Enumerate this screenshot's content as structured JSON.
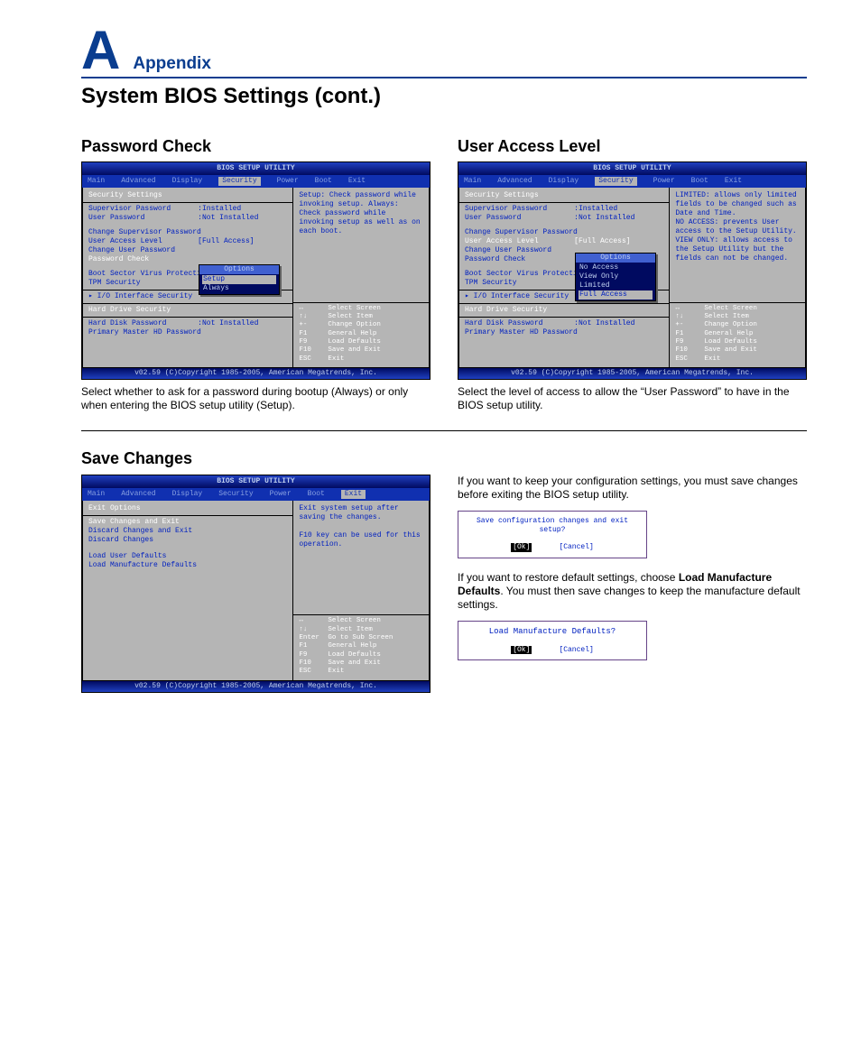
{
  "header": {
    "letter": "A",
    "label": "Appendix"
  },
  "page_title": "System BIOS Settings (cont.)",
  "bios_common": {
    "title": "BIOS SETUP UTILITY",
    "footer": "v02.59 (C)Copyright 1985-2005, American Megatrends, Inc.",
    "tabs": [
      "Main",
      "Advanced",
      "Display",
      "Security",
      "Power",
      "Boot",
      "Exit"
    ],
    "keyhelp": [
      [
        "↔",
        "Select Screen"
      ],
      [
        "↑↓",
        "Select Item"
      ],
      [
        "+-",
        "Change Option"
      ],
      [
        "F1",
        "General Help"
      ],
      [
        "F9",
        "Load Defaults"
      ],
      [
        "F10",
        "Save and Exit"
      ],
      [
        "ESC",
        "Exit"
      ]
    ],
    "keyhelp_exit": [
      [
        "↔",
        "Select Screen"
      ],
      [
        "↑↓",
        "Select Item"
      ],
      [
        "Enter",
        "Go to Sub Screen"
      ],
      [
        "F1",
        "General Help"
      ],
      [
        "F9",
        "Load Defaults"
      ],
      [
        "F10",
        "Save and Exit"
      ],
      [
        "ESC",
        "Exit"
      ]
    ]
  },
  "password_check": {
    "title": "Password Check",
    "active_tab": "Security",
    "section_header": "Security Settings",
    "rows": [
      {
        "k": "Supervisor Password",
        "v": ":Installed"
      },
      {
        "k": "User Password",
        "v": ":Not Installed"
      }
    ],
    "items1": [
      "Change Supervisor Password"
    ],
    "user_access_row": {
      "k": "User Access Level",
      "v": "[Full Access]"
    },
    "items1b": [
      "Change User Password"
    ],
    "selected": "Password Check",
    "popup": {
      "title": "Options",
      "items": [
        "Setup",
        "Always"
      ],
      "selected": "Setup"
    },
    "items2": [
      "Boot Sector Virus Protectio",
      "TPM Security"
    ],
    "items3": [
      "▸ I/O Interface Security"
    ],
    "section4": "Hard Drive Security",
    "rows4": [
      {
        "k": "Hard Disk Password",
        "v": ":Not Installed"
      }
    ],
    "items4": [
      "Primary Master HD Password"
    ],
    "help": "Setup: Check password while invoking setup. Always: Check password while invoking setup as well as on each boot.",
    "caption": "Select whether to ask for a password during bootup (Always) or only when entering the BIOS setup utility (Setup)."
  },
  "user_access": {
    "title": "User Access Level",
    "active_tab": "Security",
    "section_header": "Security Settings",
    "rows": [
      {
        "k": "Supervisor Password",
        "v": ":Installed"
      },
      {
        "k": "User Password",
        "v": ":Not Installed"
      }
    ],
    "items1": [
      "Change Supervisor Password"
    ],
    "selected": "User Access Level",
    "selected_val": "[Full Access]",
    "popup": {
      "title": "Options",
      "items": [
        "No Access",
        "View Only",
        "Limited",
        "Full Access"
      ],
      "selected": "Full Access"
    },
    "items1b": [
      "Change User Password",
      "Password Check"
    ],
    "items2": [
      "Boot Sector Virus Protectio",
      "TPM Security"
    ],
    "items3": [
      "▸ I/O Interface Security"
    ],
    "section4": "Hard Drive Security",
    "rows4": [
      {
        "k": "Hard Disk Password",
        "v": ":Not Installed"
      }
    ],
    "items4": [
      "Primary Master HD Password"
    ],
    "help": "LIMITED: allows only limited fields to be changed such as Date and Time.\nNO ACCESS: prevents User access to the Setup Utility.\nVIEW ONLY: allows access to the Setup Utility but the fields can not be changed.",
    "caption": "Select the level of access to allow the “User Password” to have in the BIOS setup utility."
  },
  "save_changes": {
    "title": "Save Changes",
    "active_tab": "Exit",
    "section_header": "Exit Options",
    "items1": [
      "Save Changes and Exit",
      "Discard Changes and Exit",
      "Discard Changes"
    ],
    "selected": "Save Changes and Exit",
    "items2": [
      "Load User Defaults",
      "Load Manufacture Defaults"
    ],
    "help": "Exit system setup after saving the changes.\n\nF10 key can be used for this operation.",
    "para1_a": "If you want to keep your configuration settings, you must save changes before exiting the BIOS setup utility.",
    "dialog1": {
      "q": "Save configuration changes and exit setup?",
      "ok": "[Ok]",
      "cancel": "[Cancel]"
    },
    "para2_a": "If you want to restore default settings, choose ",
    "para2_b": "Load Manufacture Defaults",
    "para2_c": ". You must then save changes to keep the manufacture default settings.",
    "dialog2": {
      "q": "Load Manufacture Defaults?",
      "ok": "[Ok]",
      "cancel": "[Cancel]"
    }
  }
}
